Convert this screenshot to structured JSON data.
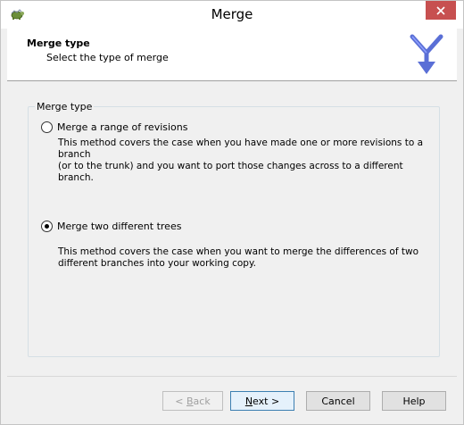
{
  "window": {
    "title": "Merge",
    "app_icon": "tortoise-icon",
    "close_icon": "close-icon"
  },
  "header": {
    "title": "Merge type",
    "subtitle": "Select the type of merge",
    "logo_icon": "merge-branches-icon",
    "logo_color": "#5a6fd6"
  },
  "group": {
    "legend": "Merge type",
    "options": [
      {
        "label": "Merge a range of revisions",
        "checked": false,
        "description_line1": "This method covers the case when you have made one or more revisions to a branch",
        "description_line2": "(or to the trunk) and you want to port those changes across to a different branch."
      },
      {
        "label": "Merge two different trees",
        "checked": true,
        "description_line1": "This method covers the case when you want to merge the differences of two",
        "description_line2": "different branches into your working copy."
      }
    ]
  },
  "buttons": {
    "back": {
      "prefix": "< ",
      "mnemonic": "B",
      "rest": "ack"
    },
    "next": {
      "mnemonic": "N",
      "rest": "ext >"
    },
    "cancel": "Cancel",
    "help": "Help"
  },
  "colors": {
    "close_button": "#c75050",
    "default_button_border": "#3c7fb1"
  }
}
